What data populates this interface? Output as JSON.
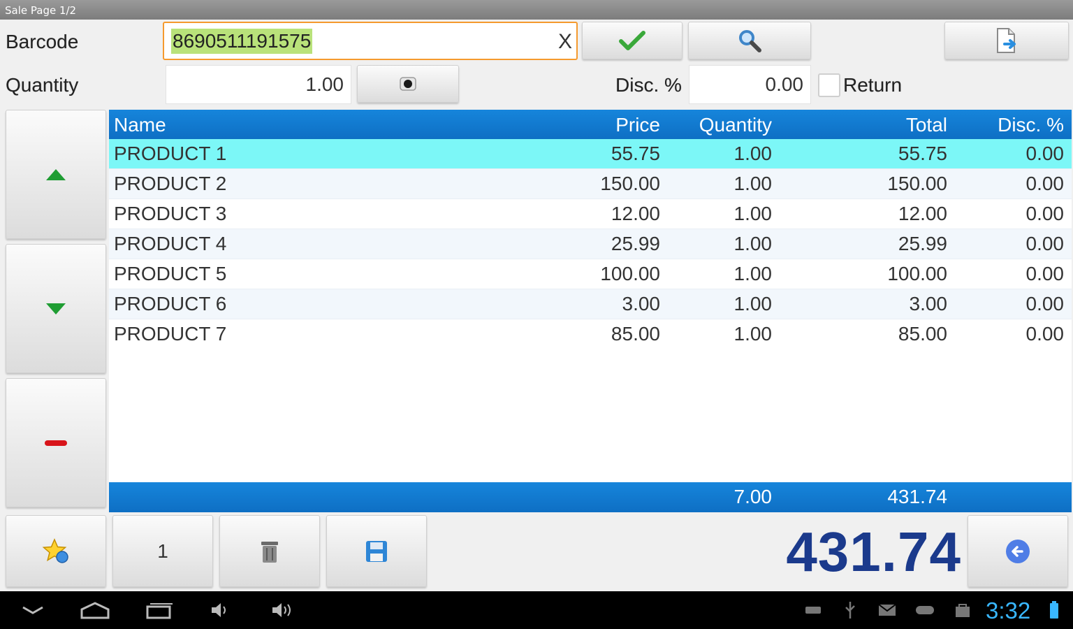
{
  "window": {
    "title": "Sale Page 1/2"
  },
  "form": {
    "barcode_label": "Barcode",
    "barcode_value": "8690511191575",
    "clear_label": "X",
    "quantity_label": "Quantity",
    "quantity_value": "1.00",
    "disc_label": "Disc. %",
    "disc_value": "0.00",
    "return_label": "Return",
    "return_checked": false
  },
  "grid": {
    "columns": [
      "Name",
      "Price",
      "Quantity",
      "Total",
      "Disc. %"
    ],
    "rows": [
      {
        "name": "PRODUCT 1",
        "price": "55.75",
        "qty": "1.00",
        "total": "55.75",
        "disc": "0.00"
      },
      {
        "name": "PRODUCT 2",
        "price": "150.00",
        "qty": "1.00",
        "total": "150.00",
        "disc": "0.00"
      },
      {
        "name": "PRODUCT 3",
        "price": "12.00",
        "qty": "1.00",
        "total": "12.00",
        "disc": "0.00"
      },
      {
        "name": "PRODUCT 4",
        "price": "25.99",
        "qty": "1.00",
        "total": "25.99",
        "disc": "0.00"
      },
      {
        "name": "PRODUCT 5",
        "price": "100.00",
        "qty": "1.00",
        "total": "100.00",
        "disc": "0.00"
      },
      {
        "name": "PRODUCT 6",
        "price": "3.00",
        "qty": "1.00",
        "total": "3.00",
        "disc": "0.00"
      },
      {
        "name": "PRODUCT 7",
        "price": "85.00",
        "qty": "1.00",
        "total": "85.00",
        "disc": "0.00"
      }
    ],
    "footer": {
      "qty": "7.00",
      "total": "431.74"
    }
  },
  "bottom": {
    "count_label": "1",
    "grand_total": "431.74"
  },
  "status": {
    "clock": "3:32"
  },
  "colors": {
    "accent_blue": "#1685db",
    "selected_row": "#7cf7f7",
    "barcode_border": "#f59a2e",
    "barcode_highlight": "#b9e27a",
    "total_text": "#1b3a8c",
    "clock": "#39b7ff"
  },
  "icons": {
    "confirm": "check-icon",
    "search": "magnifier-icon",
    "export": "document-arrow-icon",
    "camera": "camera-icon",
    "up": "triangle-up-icon",
    "down": "triangle-down-icon",
    "remove": "minus-icon",
    "favorites": "star-icon",
    "delete": "trash-icon",
    "save": "floppy-icon",
    "back": "back-arrow-icon"
  }
}
